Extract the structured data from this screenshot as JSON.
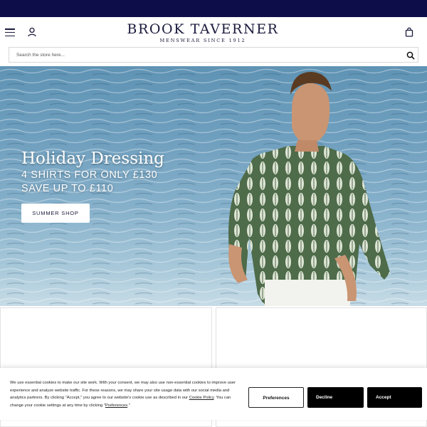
{
  "brand": {
    "name": "BROOK TAVERNER",
    "tagline": "MENSWEAR SINCE 1912",
    "primary_color": "#0d0d4a"
  },
  "header": {
    "menu_icon": "hamburger-menu-icon",
    "account_icon": "user-icon",
    "bag_icon": "shopping-bag-icon"
  },
  "search": {
    "placeholder": "Search the store here...",
    "icon": "search-icon"
  },
  "hero": {
    "title": "Holiday Dressing",
    "line1": "4 SHIRTS FOR ONLY £130",
    "line2": "SAVE UP TO £110",
    "button": "SUMMER SHOP"
  },
  "cookie_banner": {
    "text_before": "We use essential cookies to make our site work. With your consent, we may also use non-essential cookies to improve user experience and analyze website traffic. For these reasons, we may share your site usage data with our social media and analytics partners. By clicking \"Accept,\" you agree to our website's cookie use as described in our ",
    "policy_link": "Cookie Policy",
    "text_middle": ". You can change your cookie settings at any time by clicking \"",
    "preferences_link": "Preferences",
    "text_after": ".\"",
    "preferences_button": "Preferences",
    "decline_button": "Decline",
    "accept_button": "Accept"
  }
}
